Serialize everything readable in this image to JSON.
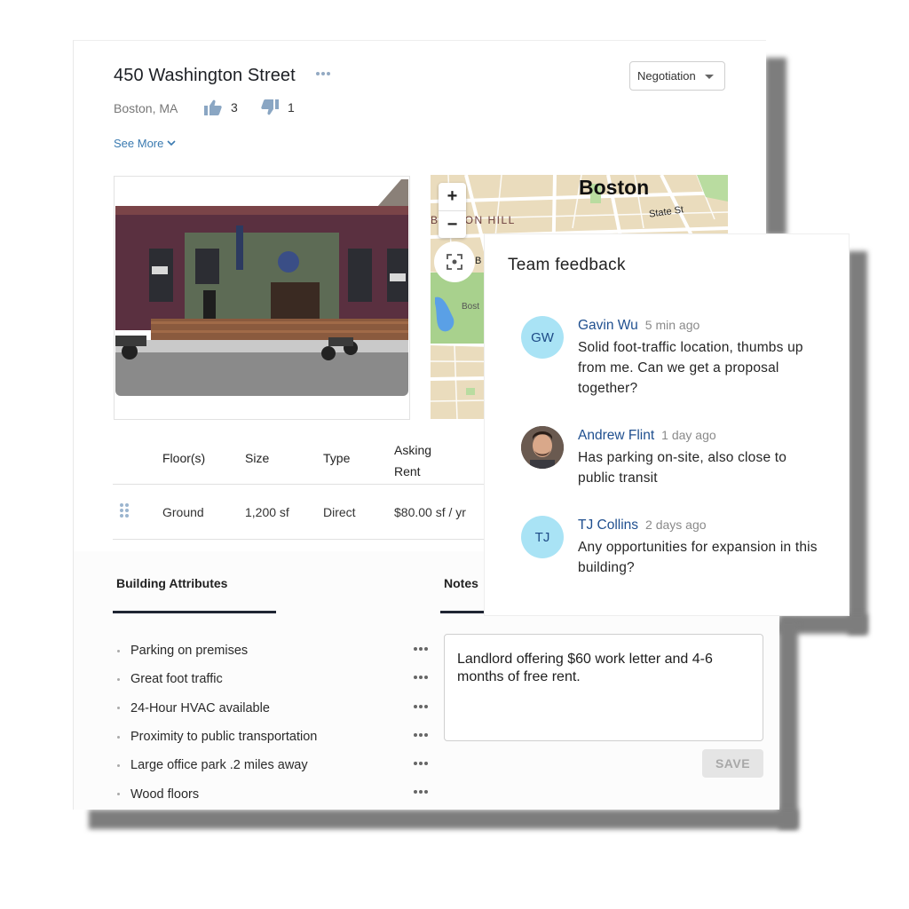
{
  "listing": {
    "title": "450 Washington Street",
    "location": "Boston, MA",
    "thumbs_up_count": "3",
    "thumbs_down_count": "1",
    "see_more_label": "See More",
    "status": {
      "selected": "Negotiation"
    }
  },
  "map": {
    "city_label": "Boston",
    "street_label": "State St",
    "neighborhood_label": "BEACON HILL",
    "partial_label_1": "B",
    "partial_label_2": "Bost",
    "zoom_in_label": "+",
    "zoom_out_label": "−"
  },
  "space_table": {
    "columns": [
      "Floor(s)",
      "Size",
      "Type",
      "Asking",
      "Rent"
    ],
    "rows": [
      {
        "floor": "Ground",
        "size": "1,200 sf",
        "type": "Direct",
        "asking_rent": "$80.00 sf / yr"
      }
    ]
  },
  "tabs": {
    "building_attributes": "Building Attributes",
    "notes": "Notes"
  },
  "building_attributes": [
    "Parking on premises",
    "Great foot traffic",
    "24-Hour HVAC available",
    "Proximity to public transportation",
    "Large office park .2 miles away",
    "Wood floors"
  ],
  "notes": {
    "value": "Landlord offering $60 work letter and 4-6 months of free rent.",
    "save_label": "SAVE"
  },
  "feedback": {
    "title": "Team feedback",
    "items": [
      {
        "initials": "GW",
        "name": "Gavin Wu",
        "time": "5 min ago",
        "text": "Solid foot-traffic location, thumbs up from me. Can we get a proposal together?"
      },
      {
        "initials": "",
        "name": "Andrew Flint",
        "time": "1 day ago",
        "text": "Has parking on-site, also close to public transit"
      },
      {
        "initials": "TJ",
        "name": "TJ Collins",
        "time": "2 days ago",
        "text": "Any opportunities for expansion in this building?"
      }
    ]
  },
  "colors": {
    "link_blue": "#3a7ab0",
    "name_blue": "#1f4f8f",
    "avatar_bg": "#a9e3f5",
    "tab_underline": "#1f2533"
  }
}
